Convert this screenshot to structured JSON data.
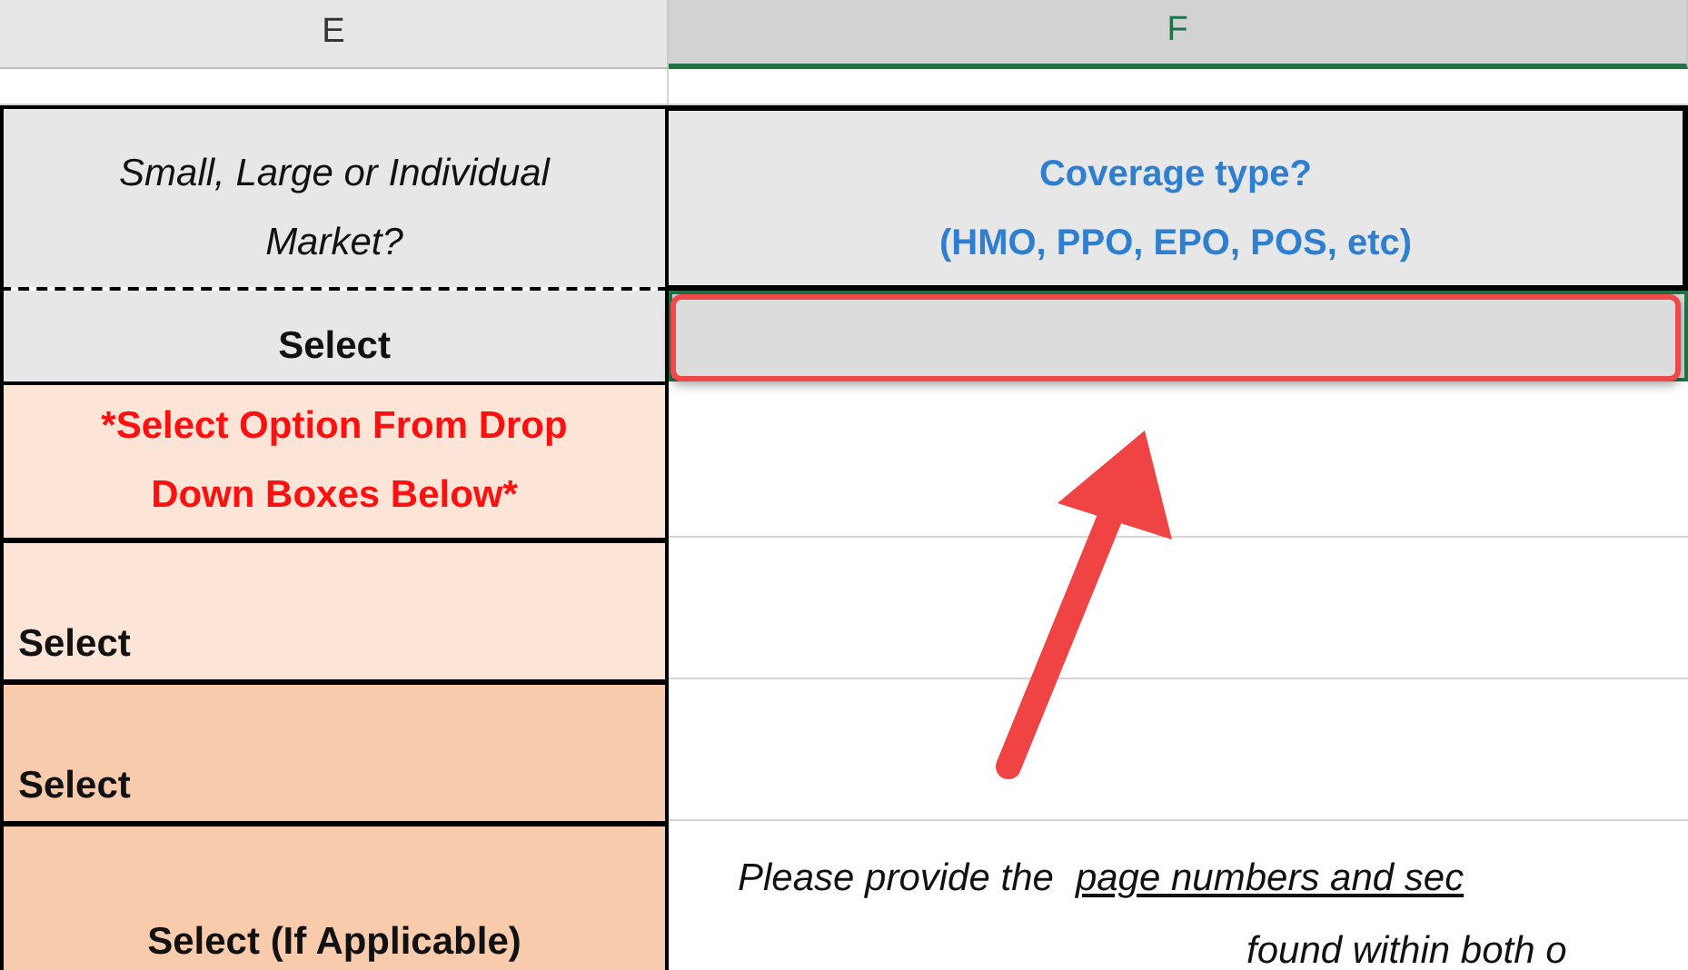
{
  "columns": [
    {
      "letter": "E",
      "selected": false
    },
    {
      "letter": "F",
      "selected": true
    }
  ],
  "header": {
    "market": "Small, Large or Individual Market?",
    "coverage": "Coverage type?",
    "coverage_examples": "(HMO, PPO, EPO, POS, etc)"
  },
  "select_row": {
    "label": "Select"
  },
  "note": {
    "lines": [
      "*Select Option From Drop",
      "Down Boxes Below*"
    ]
  },
  "rows": [
    {
      "label": "Select",
      "kind": "light"
    },
    {
      "label": "Select",
      "kind": "dark"
    }
  ],
  "last_row": {
    "label": "Select (If Applicable)",
    "text_parts": [
      {
        "text": "Please provide the",
        "underline": false
      },
      {
        "text": "page numbers and sec",
        "underline": true
      }
    ],
    "text_line2": "found within both o"
  }
}
